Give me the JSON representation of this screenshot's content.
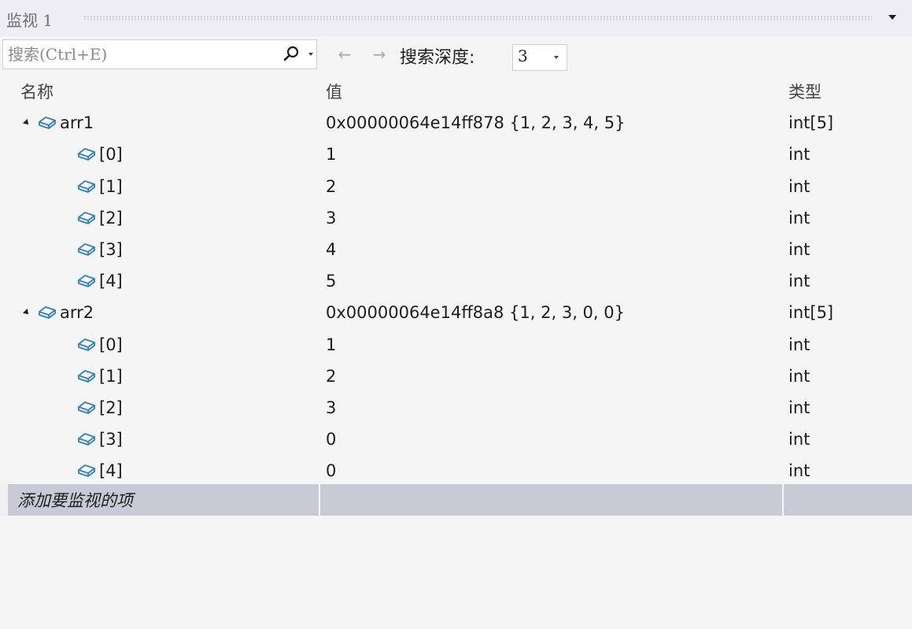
{
  "window": {
    "title": "监视 1"
  },
  "toolbar": {
    "search_placeholder": "搜索(Ctrl+E)",
    "back_glyph": "←",
    "forward_glyph": "→",
    "depth_label": "搜索深度:",
    "depth_value": "3"
  },
  "columns": {
    "name": "名称",
    "value": "值",
    "type": "类型"
  },
  "rows": [
    {
      "name": "arr1",
      "value": "0x00000064e14ff878 {1, 2, 3, 4, 5}",
      "type": "int[5]",
      "level": 0,
      "expanded": true
    },
    {
      "name": "[0]",
      "value": "1",
      "type": "int",
      "level": 1
    },
    {
      "name": "[1]",
      "value": "2",
      "type": "int",
      "level": 1
    },
    {
      "name": "[2]",
      "value": "3",
      "type": "int",
      "level": 1
    },
    {
      "name": "[3]",
      "value": "4",
      "type": "int",
      "level": 1
    },
    {
      "name": "[4]",
      "value": "5",
      "type": "int",
      "level": 1
    },
    {
      "name": "arr2",
      "value": "0x00000064e14ff8a8 {1, 2, 3, 0, 0}",
      "type": "int[5]",
      "level": 0,
      "expanded": true
    },
    {
      "name": "[0]",
      "value": "1",
      "type": "int",
      "level": 1
    },
    {
      "name": "[1]",
      "value": "2",
      "type": "int",
      "level": 1
    },
    {
      "name": "[2]",
      "value": "3",
      "type": "int",
      "level": 1
    },
    {
      "name": "[3]",
      "value": "0",
      "type": "int",
      "level": 1
    },
    {
      "name": "[4]",
      "value": "0",
      "type": "int",
      "level": 1
    }
  ],
  "add_item_label": "添加要监视的项",
  "colors": {
    "icon_blue": "#2f7fc9",
    "add_row_bg": "#c9cad6",
    "title_bg": "#eeeef2"
  }
}
